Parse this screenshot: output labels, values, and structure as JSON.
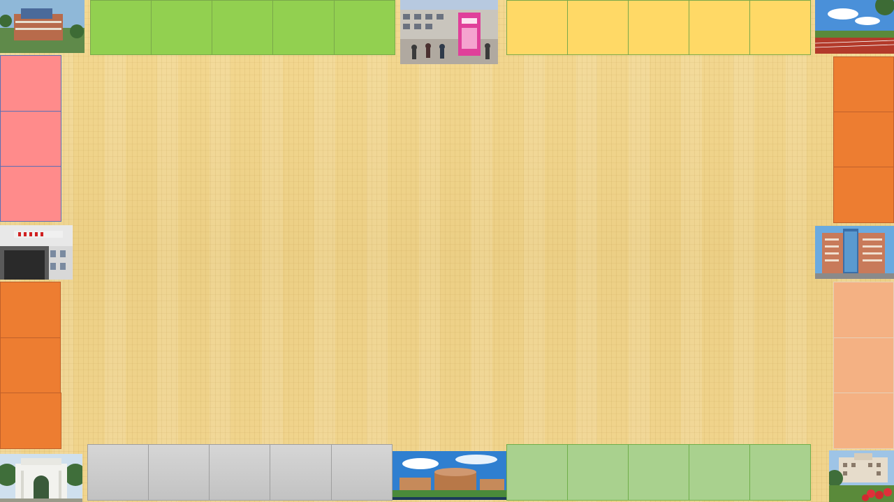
{
  "board": {
    "background": "papyrus",
    "top_left_group": {
      "color": "#92d050",
      "border": "#7aa84a",
      "count": 5
    },
    "top_right_group": {
      "color": "#ffd966",
      "border": "#7aa84a",
      "count": 5
    },
    "left_upper_group": {
      "color": "#ff8b8b",
      "border": "#5b6fb5",
      "count": 3
    },
    "left_lower_group": {
      "color": "#ed7d31",
      "border": "#c0602a",
      "count": 3
    },
    "right_upper_group": {
      "color": "#ed7d31",
      "border": "#c0602a",
      "count": 3
    },
    "right_lower_group": {
      "color": "#f4b183",
      "border": "#e6d0b8",
      "count": 3
    },
    "bottom_left_group": {
      "color": "#cccccc",
      "border": "#9e9e9e",
      "count": 5
    },
    "bottom_right_group": {
      "color": "#a9d18e",
      "border": "#6fae4a",
      "count": 5
    }
  },
  "photos": [
    {
      "id": "corner-top-left",
      "subject": "campus-building-aerial"
    },
    {
      "id": "top-middle",
      "subject": "courtyard-poster"
    },
    {
      "id": "corner-top-right",
      "subject": "sports-track"
    },
    {
      "id": "left-middle",
      "subject": "hospital-building"
    },
    {
      "id": "right-middle",
      "subject": "glass-office-tower"
    },
    {
      "id": "corner-bottom-left",
      "subject": "stone-gate"
    },
    {
      "id": "bottom-middle",
      "subject": "library-panorama"
    },
    {
      "id": "corner-bottom-right",
      "subject": "administration-building"
    }
  ]
}
